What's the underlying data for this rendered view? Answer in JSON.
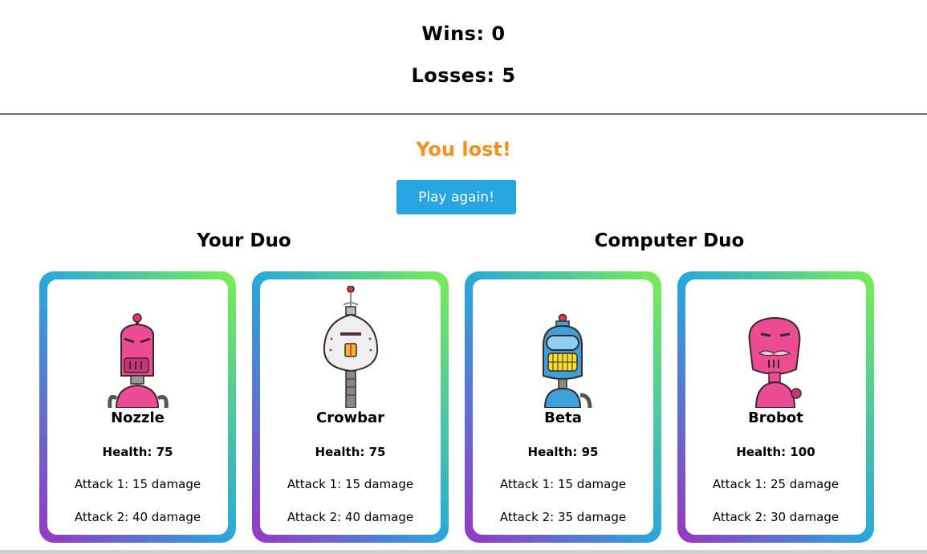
{
  "score": {
    "wins": "Wins: 0",
    "losses": "Losses: 5"
  },
  "result": {
    "message": "You lost!",
    "color": "#f0921c"
  },
  "play_again": {
    "label": "Play again!",
    "color": "#27a5df"
  },
  "duos": {
    "player_title": "Your Duo",
    "computer_title": "Computer Duo"
  },
  "cards": [
    {
      "name": "Nozzle",
      "health": "Health: 75",
      "attack1": "Attack 1: 15 damage",
      "attack2": "Attack 2: 40 damage",
      "robot_icon": "pink-robot-icon"
    },
    {
      "name": "Crowbar",
      "health": "Health: 75",
      "attack1": "Attack 1: 15 damage",
      "attack2": "Attack 2: 40 damage",
      "robot_icon": "white-robot-icon"
    },
    {
      "name": "Beta",
      "health": "Health: 95",
      "attack1": "Attack 1: 15 damage",
      "attack2": "Attack 2: 35 damage",
      "robot_icon": "blue-robot-icon"
    },
    {
      "name": "Brobot",
      "health": "Health: 100",
      "attack1": "Attack 1: 25 damage",
      "attack2": "Attack 2: 30 damage",
      "robot_icon": "mustache-robot-icon"
    }
  ]
}
